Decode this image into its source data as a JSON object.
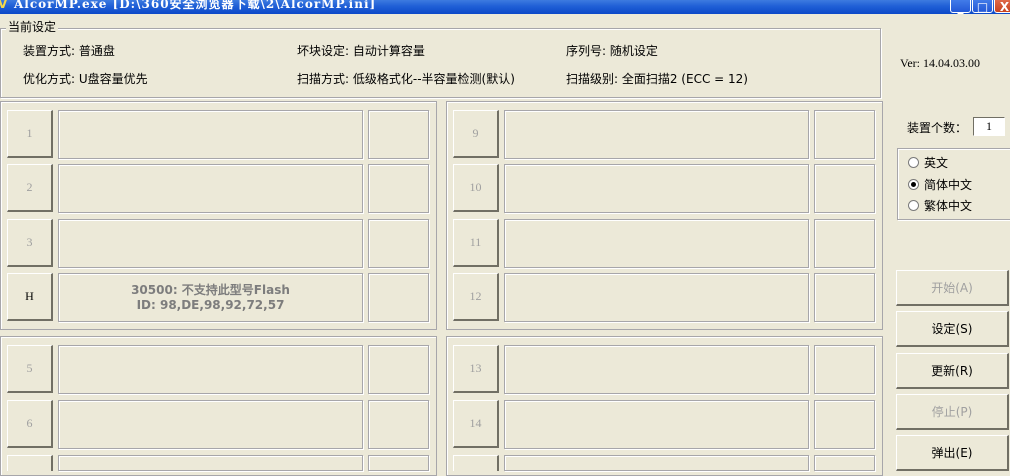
{
  "window": {
    "title": "AlcorMP.exe [D:\\360安全浏览器下载\\2\\AlcorMP.ini]",
    "icon": "app-icon",
    "controls": {
      "minimize": "_",
      "maximize": "□",
      "close": "X"
    }
  },
  "settings": {
    "legend": "当前设定",
    "device_mode": "装置方式: 普通盘",
    "bad_block": "坏块设定: 自动计算容量",
    "serial": "序列号: 随机设定",
    "optimize": "优化方式: U盘容量优先",
    "scan_mode": "扫描方式: 低级格式化--半容量检测(默认)",
    "scan_level": "扫描级别: 全面扫描2 (ECC = 12)"
  },
  "version": "Ver: 14.04.03.00",
  "ports": {
    "left_top": [
      {
        "label": "1",
        "message1": "",
        "message2": ""
      },
      {
        "label": "2",
        "message1": "",
        "message2": ""
      },
      {
        "label": "3",
        "message1": "",
        "message2": ""
      },
      {
        "label": "H",
        "message1": "30500: 不支持此型号Flash",
        "message2": "ID: 98,DE,98,92,72,57"
      }
    ],
    "right_top": [
      {
        "label": "9"
      },
      {
        "label": "10"
      },
      {
        "label": "11"
      },
      {
        "label": "12"
      }
    ],
    "left_bottom": [
      {
        "label": "5"
      },
      {
        "label": "6"
      }
    ],
    "right_bottom": [
      {
        "label": "13"
      },
      {
        "label": "14"
      }
    ]
  },
  "device_count": {
    "label": "装置个数：",
    "value": "1"
  },
  "language": {
    "options": [
      "英文",
      "简体中文",
      "繁体中文"
    ],
    "selected": "简体中文"
  },
  "buttons": {
    "start": "开始(A)",
    "settings": "设定(S)",
    "refresh": "更新(R)",
    "stop": "停止(P)",
    "eject": "弹出(E)"
  }
}
